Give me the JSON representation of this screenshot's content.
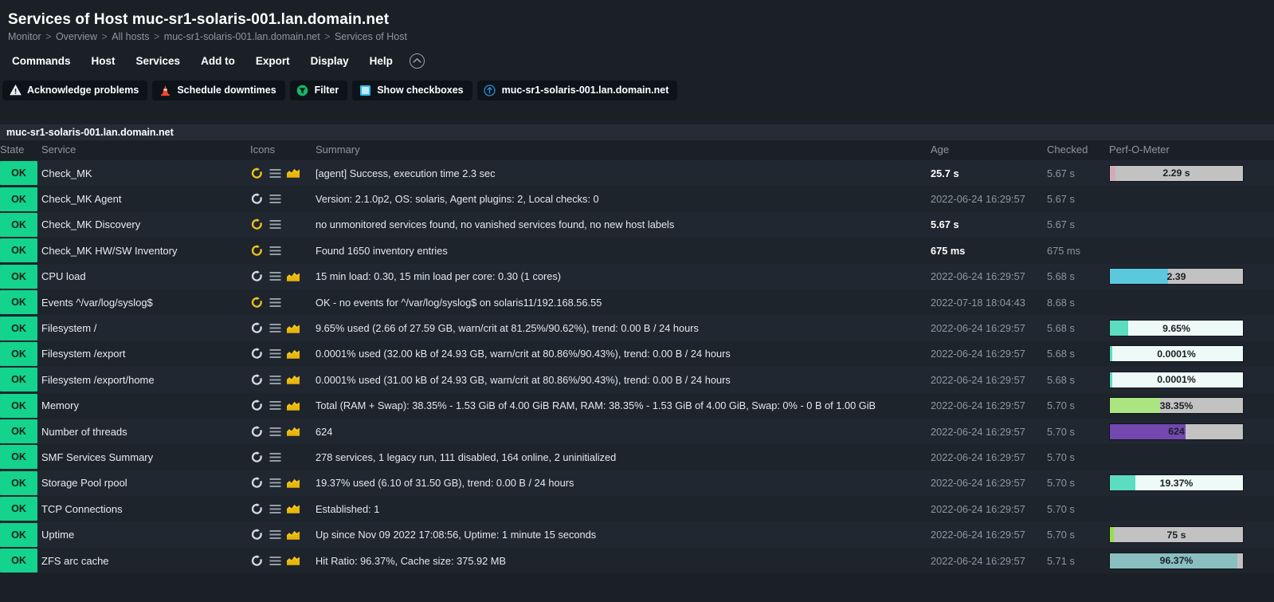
{
  "header": {
    "title": "Services of Host muc-sr1-solaris-001.lan.domain.net",
    "breadcrumb": [
      "Monitor",
      "Overview",
      "All hosts",
      "muc-sr1-solaris-001.lan.domain.net",
      "Services of Host"
    ],
    "breadcrumb_separator": ">"
  },
  "menubar": {
    "items": [
      {
        "label": "Commands",
        "name": "menu-commands"
      },
      {
        "label": "Host",
        "name": "menu-host"
      },
      {
        "label": "Services",
        "name": "menu-services"
      },
      {
        "label": "Add to",
        "name": "menu-add-to"
      },
      {
        "label": "Export",
        "name": "menu-export"
      },
      {
        "label": "Display",
        "name": "menu-display"
      },
      {
        "label": "Help",
        "name": "menu-help"
      }
    ],
    "collapse_icon": "chevron-up-circle-icon"
  },
  "actionbar": {
    "buttons": [
      {
        "label": "Acknowledge problems",
        "icon": "warning-triangle-icon",
        "name": "acknowledge-problems-button"
      },
      {
        "label": "Schedule downtimes",
        "icon": "traffic-cone-icon",
        "name": "schedule-downtimes-button"
      },
      {
        "label": "Filter",
        "icon": "filter-funnel-icon",
        "name": "filter-button"
      },
      {
        "label": "Show checkboxes",
        "icon": "checkbox-icon",
        "name": "show-checkboxes-button"
      },
      {
        "label": "muc-sr1-solaris-001.lan.domain.net",
        "icon": "arrow-up-circle-icon",
        "name": "host-link-button"
      }
    ]
  },
  "table": {
    "host_group_label": "muc-sr1-solaris-001.lan.domain.net",
    "columns": [
      "State",
      "Service",
      "Icons",
      "Summary",
      "Age",
      "Checked",
      "Perf-O-Meter"
    ],
    "rows": [
      {
        "state": "OK",
        "service": "Check_MK",
        "icons": [
          "reload-icon-yellow",
          "menu-icon",
          "graph-icon"
        ],
        "summary": "[agent] Success, execution time 2.3 sec",
        "age": "25.7 s",
        "age_bold": true,
        "checked": "5.67 s",
        "perf": {
          "label": "2.29 s",
          "fill_pct": 4,
          "fill_color": "#d4aab8",
          "track_color": "#c2c2c2"
        }
      },
      {
        "state": "OK",
        "service": "Check_MK Agent",
        "icons": [
          "reload-icon-white",
          "menu-icon"
        ],
        "summary": "Version: 2.1.0p2, OS: solaris, Agent plugins: 2, Local checks: 0",
        "age": "2022-06-24 16:29:57",
        "age_bold": false,
        "checked": "5.67 s",
        "perf": null
      },
      {
        "state": "OK",
        "service": "Check_MK Discovery",
        "icons": [
          "reload-icon-yellow",
          "menu-icon"
        ],
        "summary": "no unmonitored services found, no vanished services found, no new host labels",
        "age": "5.67 s",
        "age_bold": true,
        "checked": "5.67 s",
        "perf": null
      },
      {
        "state": "OK",
        "service": "Check_MK HW/SW Inventory",
        "icons": [
          "reload-icon-yellow",
          "menu-icon"
        ],
        "summary": "Found 1650 inventory entries",
        "age": "675 ms",
        "age_bold": true,
        "checked": "675 ms",
        "perf": null
      },
      {
        "state": "OK",
        "service": "CPU load",
        "icons": [
          "reload-icon-white",
          "menu-icon",
          "graph-icon"
        ],
        "summary": "15 min load: 0.30, 15 min load per core: 0.30 (1 cores)",
        "age": "2022-06-24 16:29:57",
        "age_bold": false,
        "checked": "5.68 s",
        "perf": {
          "label": "2.39",
          "fill_pct": 44,
          "fill_color": "#5bc8dd",
          "track_color": "#c2c2c2"
        }
      },
      {
        "state": "OK",
        "service": "Events ^/var/log/syslog$",
        "icons": [
          "reload-icon-yellow",
          "menu-icon"
        ],
        "summary": "OK - no events for ^/var/log/syslog$ on solaris11/192.168.56.55",
        "age": "2022-07-18 18:04:43",
        "age_bold": false,
        "checked": "8.68 s",
        "perf": null
      },
      {
        "state": "OK",
        "service": "Filesystem /",
        "icons": [
          "reload-icon-white",
          "menu-icon",
          "graph-icon"
        ],
        "summary": "9.65% used (2.66 of 27.59 GB, warn/crit at 81.25%/90.62%), trend: 0.00 B / 24 hours",
        "age": "2022-06-24 16:29:57",
        "age_bold": false,
        "checked": "5.68 s",
        "perf": {
          "label": "9.65%",
          "fill_pct": 14,
          "fill_color": "#5cdcc0",
          "track_color": "#eefaf7"
        }
      },
      {
        "state": "OK",
        "service": "Filesystem /export",
        "icons": [
          "reload-icon-white",
          "menu-icon",
          "graph-icon"
        ],
        "summary": "0.0001% used (32.00 kB of 24.93 GB, warn/crit at 80.86%/90.43%), trend: 0.00 B / 24 hours",
        "age": "2022-06-24 16:29:57",
        "age_bold": false,
        "checked": "5.68 s",
        "perf": {
          "label": "0.0001%",
          "fill_pct": 1.5,
          "fill_color": "#5cdcc0",
          "track_color": "#eefaf7"
        }
      },
      {
        "state": "OK",
        "service": "Filesystem /export/home",
        "icons": [
          "reload-icon-white",
          "menu-icon",
          "graph-icon"
        ],
        "summary": "0.0001% used (31.00 kB of 24.93 GB, warn/crit at 80.86%/90.43%), trend: 0.00 B / 24 hours",
        "age": "2022-06-24 16:29:57",
        "age_bold": false,
        "checked": "5.68 s",
        "perf": {
          "label": "0.0001%",
          "fill_pct": 1.5,
          "fill_color": "#5cdcc0",
          "track_color": "#eefaf7"
        }
      },
      {
        "state": "OK",
        "service": "Memory",
        "icons": [
          "reload-icon-white",
          "menu-icon",
          "graph-icon"
        ],
        "summary": "Total (RAM + Swap): 38.35% - 1.53 GiB of 4.00 GiB RAM, RAM: 38.35% - 1.53 GiB of 4.00 GiB, Swap: 0% - 0 B of 1.00 GiB",
        "age": "2022-06-24 16:29:57",
        "age_bold": false,
        "checked": "5.70 s",
        "perf": {
          "label": "38.35%",
          "fill_pct": 38,
          "fill_color": "#aae581",
          "track_color": "#c2c2c2"
        }
      },
      {
        "state": "OK",
        "service": "Number of threads",
        "icons": [
          "reload-icon-white",
          "menu-icon",
          "graph-icon"
        ],
        "summary": "624",
        "age": "2022-06-24 16:29:57",
        "age_bold": false,
        "checked": "5.70 s",
        "perf": {
          "label": "624",
          "fill_pct": 57,
          "fill_color": "#7348b0",
          "track_color": "#c2c2c2",
          "label_color": "#1b2026"
        }
      },
      {
        "state": "OK",
        "service": "SMF Services Summary",
        "icons": [
          "reload-icon-white",
          "menu-icon"
        ],
        "summary": "278 services, 1 legacy run, 111 disabled, 164 online, 2 uninitialized",
        "age": "2022-06-24 16:29:57",
        "age_bold": false,
        "checked": "5.70 s",
        "perf": null
      },
      {
        "state": "OK",
        "service": "Storage Pool rpool",
        "icons": [
          "reload-icon-white",
          "menu-icon",
          "graph-icon"
        ],
        "summary": "19.37% used (6.10 of 31.50 GB), trend: 0.00 B / 24 hours",
        "age": "2022-06-24 16:29:57",
        "age_bold": false,
        "checked": "5.70 s",
        "perf": {
          "label": "19.37%",
          "fill_pct": 19,
          "fill_color": "#5cdcc0",
          "track_color": "#eefaf7"
        }
      },
      {
        "state": "OK",
        "service": "TCP Connections",
        "icons": [
          "reload-icon-white",
          "menu-icon",
          "graph-icon"
        ],
        "summary": "Established: 1",
        "age": "2022-06-24 16:29:57",
        "age_bold": false,
        "checked": "5.70 s",
        "perf": null
      },
      {
        "state": "OK",
        "service": "Uptime",
        "icons": [
          "reload-icon-white",
          "menu-icon",
          "graph-icon"
        ],
        "summary": "Up since Nov 09 2022 17:08:56, Uptime: 1 minute 15 seconds",
        "age": "2022-06-24 16:29:57",
        "age_bold": false,
        "checked": "5.70 s",
        "perf": {
          "label": "75 s",
          "fill_pct": 3,
          "fill_color": "#94e04a",
          "track_color": "#c2c2c2"
        }
      },
      {
        "state": "OK",
        "service": "ZFS arc cache",
        "icons": [
          "reload-icon-white",
          "menu-icon",
          "graph-icon"
        ],
        "summary": "Hit Ratio: 96.37%, Cache size: 375.92 MB",
        "age": "2022-06-24 16:29:57",
        "age_bold": false,
        "checked": "5.71 s",
        "perf": {
          "label": "96.37%",
          "fill_pct": 96,
          "fill_color": "#89bfc0",
          "track_color": "#c2c2c2"
        }
      }
    ]
  },
  "colors": {
    "page_bg": "#1b2026",
    "row_odd": "#212730",
    "row_even": "#1e242c",
    "state_ok": "#13d38d",
    "accent_yellow": "#ffd703",
    "muted_text": "#8e96a0"
  }
}
